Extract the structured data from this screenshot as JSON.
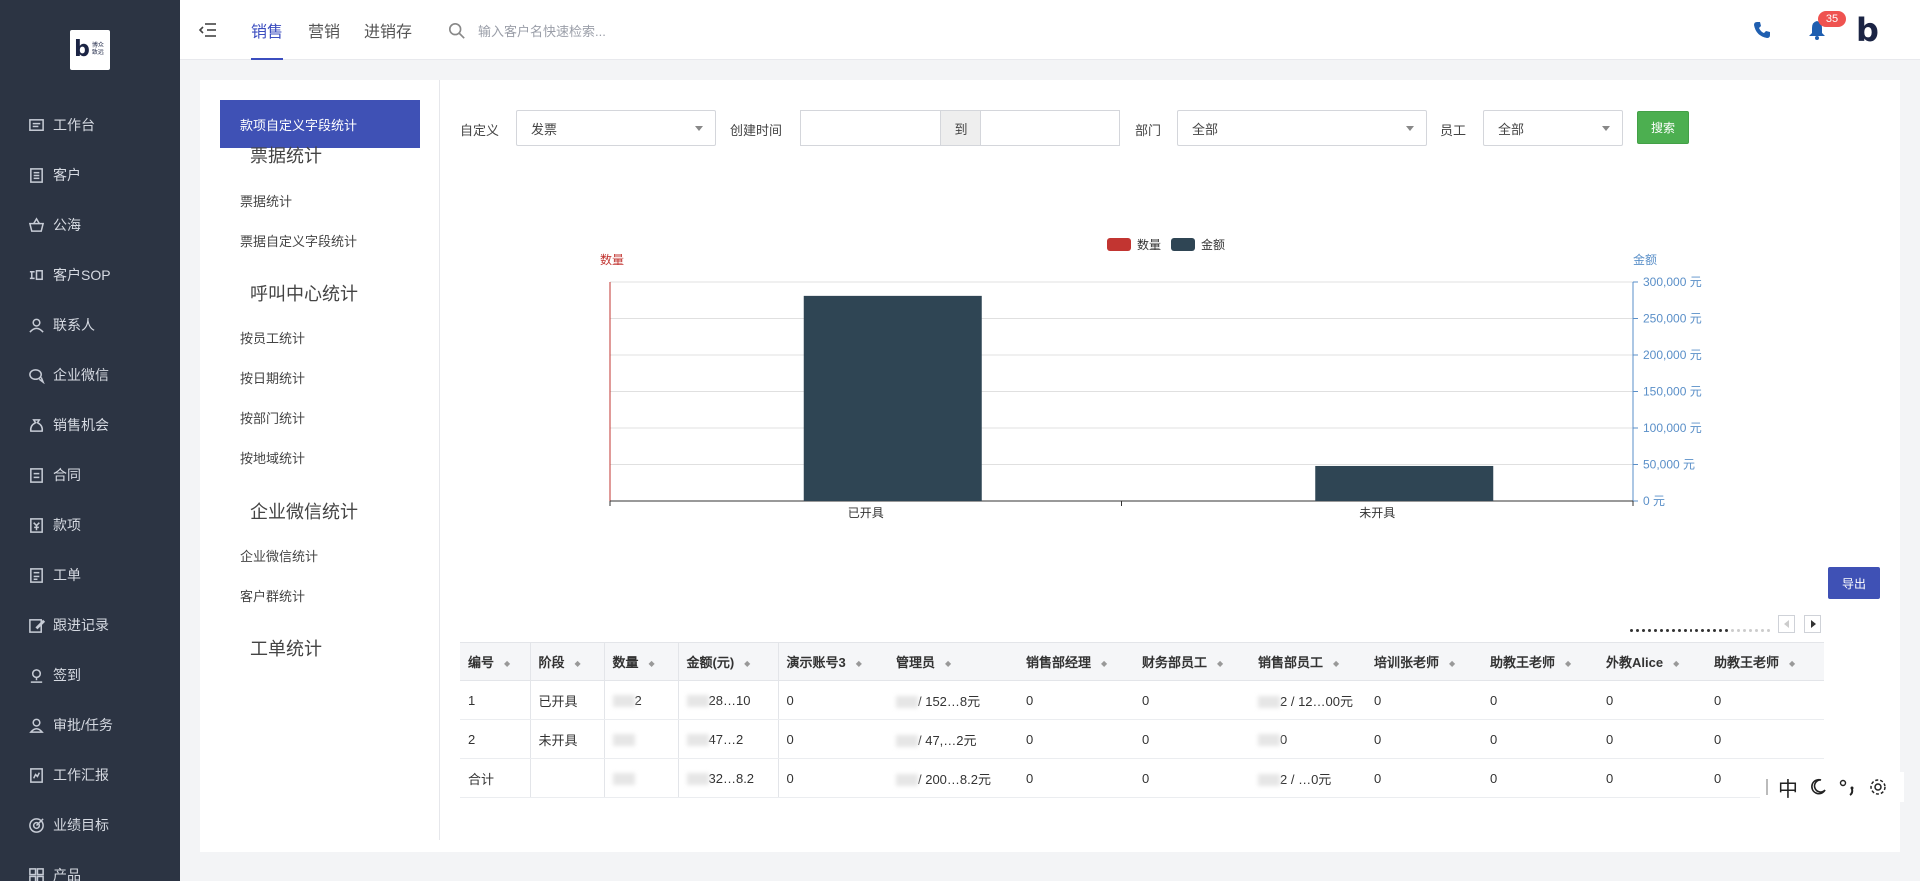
{
  "brand": {
    "logo_mark": "b",
    "logo_text": "博众致远"
  },
  "sidebar": {
    "items": [
      {
        "label": "工作台",
        "icon": "dashboard-icon"
      },
      {
        "label": "客户",
        "icon": "building-icon"
      },
      {
        "label": "公海",
        "icon": "basket-icon"
      },
      {
        "label": "客户SOP",
        "icon": "sop-icon"
      },
      {
        "label": "联系人",
        "icon": "person-icon"
      },
      {
        "label": "企业微信",
        "icon": "chat-icon"
      },
      {
        "label": "销售机会",
        "icon": "moneybag-icon"
      },
      {
        "label": "合同",
        "icon": "contract-icon"
      },
      {
        "label": "款项",
        "icon": "payment-icon"
      },
      {
        "label": "工单",
        "icon": "ticket-icon"
      },
      {
        "label": "跟进记录",
        "icon": "edit-icon"
      },
      {
        "label": "签到",
        "icon": "location-icon"
      },
      {
        "label": "审批/任务",
        "icon": "approval-icon"
      },
      {
        "label": "工作汇报",
        "icon": "report-icon"
      },
      {
        "label": "业绩目标",
        "icon": "target-icon"
      },
      {
        "label": "产品",
        "icon": "grid-icon"
      }
    ]
  },
  "header": {
    "tabs": [
      "销售",
      "营销",
      "进销存"
    ],
    "active_tab": 0,
    "search_placeholder": "输入客户名快速检索...",
    "notification_count": "35",
    "accent": "#3b4dbf"
  },
  "submenu": {
    "active": "款项自定义字段统计",
    "groups": [
      {
        "title": "票据统计",
        "items": [
          "票据统计",
          "票据自定义字段统计"
        ]
      },
      {
        "title": "呼叫中心统计",
        "items": [
          "按员工统计",
          "按日期统计",
          "按部门统计",
          "按地域统计"
        ]
      },
      {
        "title": "企业微信统计",
        "items": [
          "企业微信统计",
          "客户群统计"
        ]
      },
      {
        "title": "工单统计",
        "items": []
      }
    ]
  },
  "filters": {
    "custom_label": "自定义",
    "custom_value": "发票",
    "created_label": "创建时间",
    "to_label": "到",
    "dept_label": "部门",
    "dept_value": "全部",
    "staff_label": "员工",
    "staff_value": "全部",
    "search_button": "搜索"
  },
  "export_button": "导出",
  "chart_data": {
    "type": "bar",
    "categories": [
      "已开具",
      "未开具"
    ],
    "series": [
      {
        "name": "数量",
        "color": "#c23531",
        "axis": "left",
        "values": [
          0,
          0
        ]
      },
      {
        "name": "金额",
        "color": "#2f4554",
        "axis": "right",
        "values": [
          281000,
          48000
        ]
      }
    ],
    "ylabel_left": "数量",
    "ylabel_right": "金额",
    "right_ticks": [
      "0 元",
      "50,000 元",
      "100,000 元",
      "150,000 元",
      "200,000 元",
      "250,000 元",
      "300,000 元"
    ],
    "ylim_right": [
      0,
      300000
    ],
    "legend": "top-center",
    "grid": true
  },
  "table": {
    "headers": [
      "编号",
      "阶段",
      "数量",
      "金额(元)",
      "演示账号3",
      "管理员",
      "销售部经理",
      "财务部员工",
      "销售部员工",
      "培训张老师",
      "助教王老师",
      "外教Alice",
      "助教王老师"
    ],
    "sortable": [
      true,
      true,
      true,
      true,
      true,
      true,
      true,
      true,
      true,
      true,
      true,
      true,
      true
    ],
    "rows": [
      [
        "1",
        "已开具",
        "2",
        "28…10",
        "0",
        "/ 152…8元",
        "0",
        "0",
        "2 / 12…00元",
        "0",
        "0",
        "0",
        "0"
      ],
      [
        "2",
        "未开具",
        "",
        "47…2",
        "0",
        "/ 47,…2元",
        "0",
        "0",
        "0",
        "0",
        "0",
        "0",
        "0"
      ],
      [
        "合计",
        "",
        "",
        "32…8.2",
        "0",
        "/ 200…8.2元",
        "0",
        "0",
        "2 / …0元",
        "0",
        "0",
        "0",
        "0"
      ]
    ]
  },
  "tools": {
    "lang": "中"
  }
}
